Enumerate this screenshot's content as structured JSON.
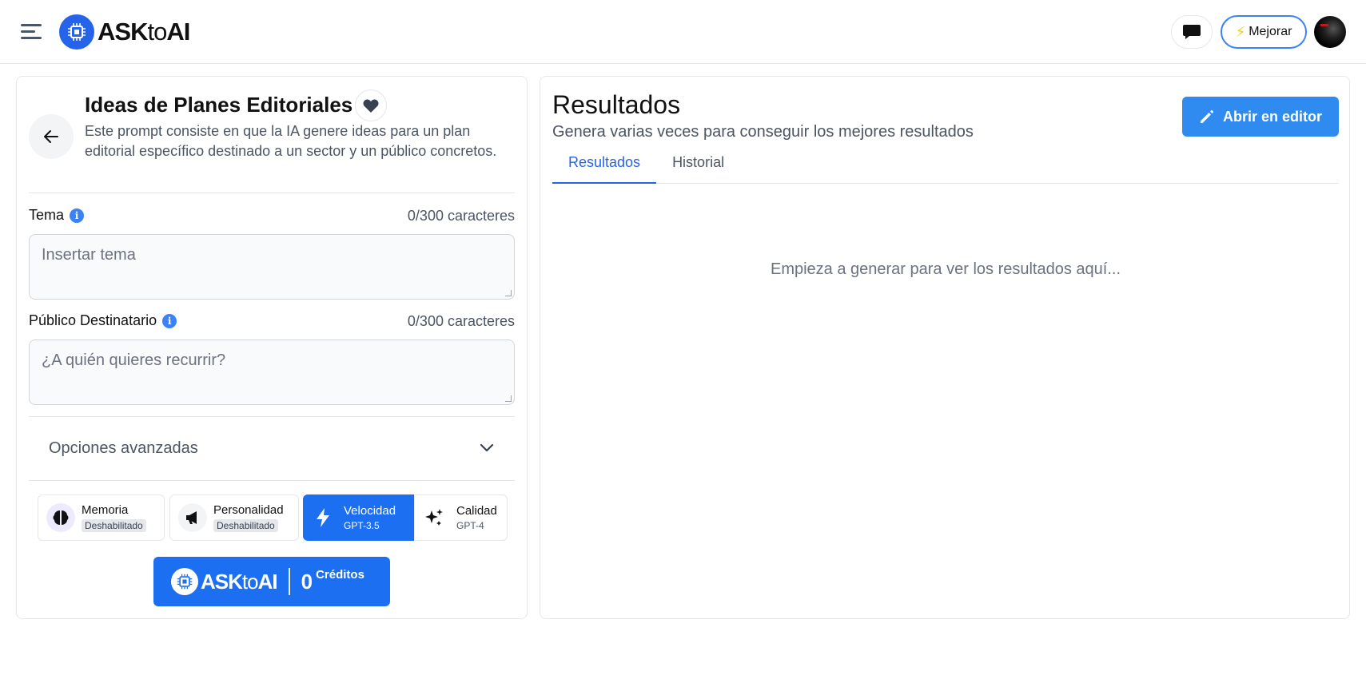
{
  "header": {
    "logo_prefix": "ASK",
    "logo_mid": "to",
    "logo_suffix": "AI",
    "upgrade_label": "Mejorar"
  },
  "tool": {
    "title": "Ideas de Planes Editoriales",
    "description": "Este prompt consiste en que la IA genere ideas para un plan editorial específico destinado a un sector y un público concretos."
  },
  "fields": [
    {
      "label": "Tema",
      "count": "0/300 caracteres",
      "placeholder": "Insertar tema"
    },
    {
      "label": "Público Destinatario",
      "count": "0/300 caracteres",
      "placeholder": "¿A quién quieres recurrir?"
    }
  ],
  "advanced": {
    "label": "Opciones avanzadas"
  },
  "options": [
    {
      "title": "Memoria",
      "sub": "Deshabilitado",
      "icon": "brain-icon"
    },
    {
      "title": "Personalidad",
      "sub": "Deshabilitado",
      "icon": "megaphone-icon"
    },
    {
      "title": "Velocidad",
      "sub": "GPT-3.5",
      "icon": "bolt-icon",
      "active": true
    },
    {
      "title": "Calidad",
      "sub": "GPT-4",
      "icon": "sparkles-icon"
    }
  ],
  "credits": {
    "logo_prefix": "ASK",
    "logo_mid": "to",
    "logo_suffix": "AI",
    "amount": "0",
    "label": "Créditos"
  },
  "results": {
    "title": "Resultados",
    "subtitle": "Genera varias veces para conseguir los mejores resultados",
    "editor_button": "Abrir en editor",
    "tabs": [
      "Resultados",
      "Historial"
    ],
    "empty_message": "Empieza a generar para ver los resultados aquí..."
  },
  "colors": {
    "accent": "#1d6ff2",
    "editor_button": "#2f8bf0",
    "tab_active": "#2563eb"
  }
}
